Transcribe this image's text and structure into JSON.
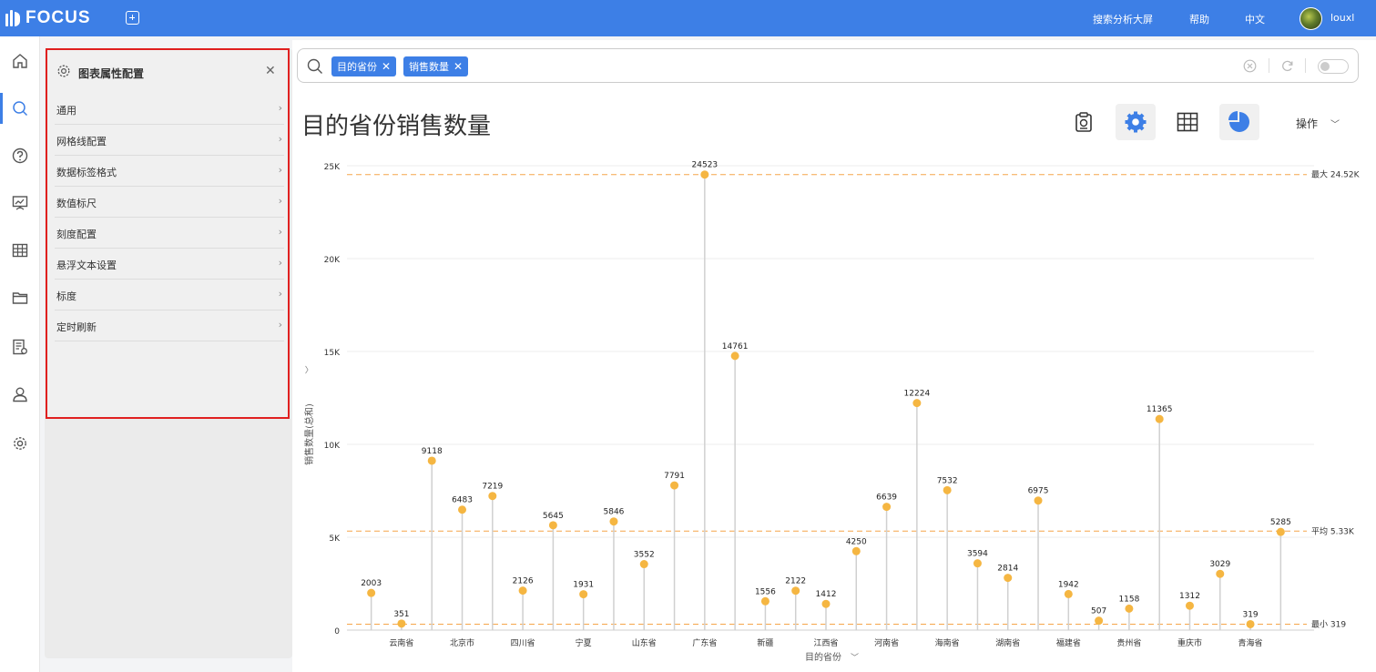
{
  "app": {
    "logo_text": "FOCUS",
    "nav": {
      "search_screen": "搜索分析大屏",
      "help": "帮助",
      "language": "中文",
      "user": "louxl"
    }
  },
  "sidebar_icons": [
    "home-icon",
    "search-icon",
    "help-icon",
    "chart-board-icon",
    "table-icon",
    "folder-icon",
    "report-settings-icon",
    "user-icon",
    "gear-icon"
  ],
  "config_panel": {
    "title": "图表属性配置",
    "items": [
      "通用",
      "网格线配置",
      "数据标签格式",
      "数值标尺",
      "刻度配置",
      "悬浮文本设置",
      "标度",
      "定时刷新"
    ]
  },
  "search": {
    "chips": [
      "目的省份",
      "销售数量"
    ]
  },
  "chart_header": {
    "title": "目的省份销售数量",
    "operations_label": "操作"
  },
  "colors": {
    "brand": "#3d7fe6",
    "highlight_border": "#e02020",
    "point": "#f5b642",
    "refline": "#f5a54a",
    "stem": "#d0d0d0"
  },
  "chart_data": {
    "type": "lollipop",
    "title": "目的省份销售数量",
    "xlabel": "目的省份",
    "ylabel": "销售数量(总和)",
    "ylim": [
      0,
      25000
    ],
    "yticks": [
      "0",
      "5K",
      "10K",
      "15K",
      "20K",
      "25K"
    ],
    "ytick_values": [
      0,
      5000,
      10000,
      15000,
      20000,
      25000
    ],
    "categories": [
      "",
      "云南省",
      "",
      "北京市",
      "",
      "四川省",
      "",
      "宁夏",
      "",
      "山东省",
      "",
      "广东省",
      "",
      "新疆",
      "",
      "江西省",
      "",
      "河南省",
      "",
      "海南省",
      "",
      "湖南省",
      "",
      "福建省",
      "",
      "贵州省",
      "",
      "重庆市",
      "",
      "青海省",
      ""
    ],
    "values": [
      2003,
      351,
      9118,
      6483,
      7219,
      2126,
      5645,
      1931,
      5846,
      3552,
      7791,
      24523,
      14761,
      1556,
      2122,
      1412,
      4250,
      6639,
      12224,
      7532,
      3594,
      2814,
      6975,
      1942,
      507,
      1158,
      11365,
      1312,
      3029,
      319,
      5285
    ],
    "reference_lines": [
      {
        "label": "最大 24.52K",
        "value": 24523
      },
      {
        "label": "平均 5.33K",
        "value": 5330
      },
      {
        "label": "最小 319",
        "value": 319
      }
    ],
    "grid": true
  }
}
